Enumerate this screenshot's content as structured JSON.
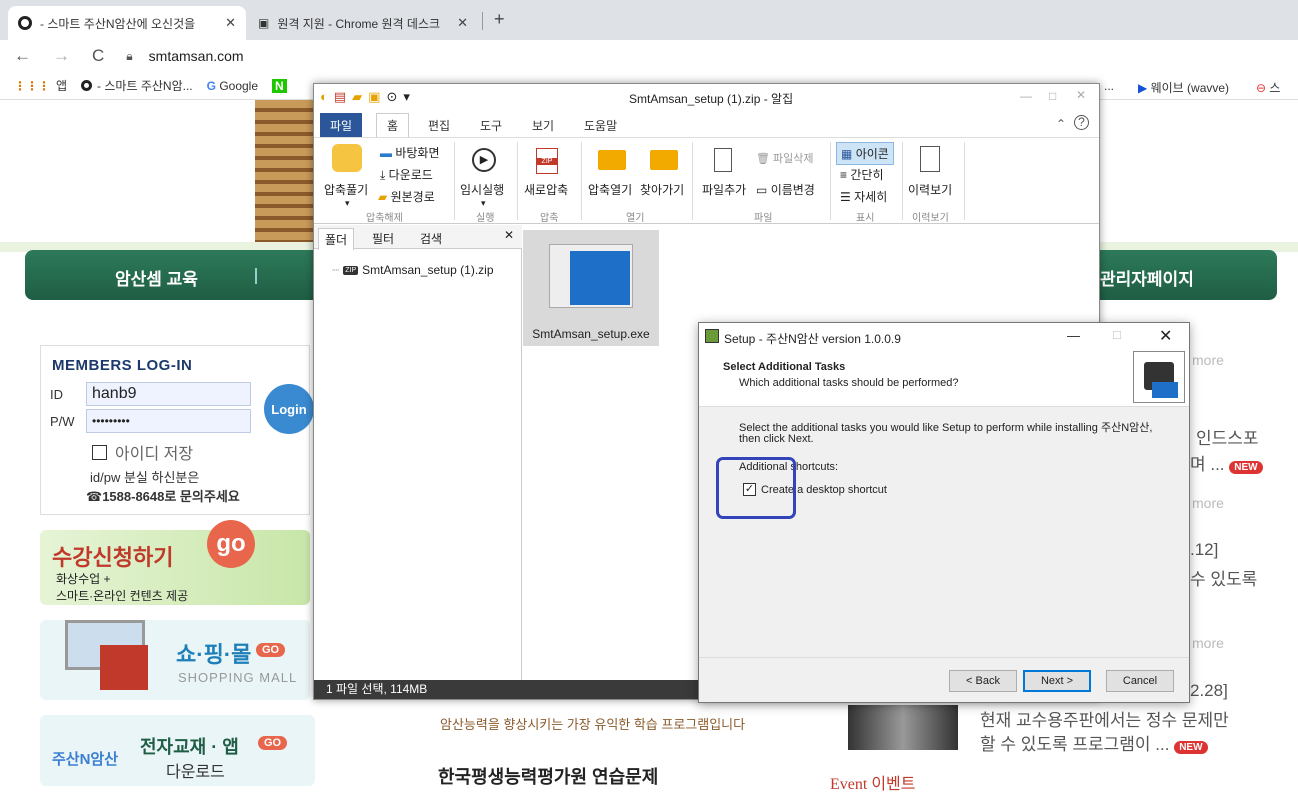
{
  "browser": {
    "tabs": [
      {
        "title": "- 스마트 주산N암산에 오신것을",
        "active": true
      },
      {
        "title": "원격 지원 - Chrome 원격 데스크",
        "active": false
      }
    ],
    "new_tab": "+",
    "url": "smtamsan.com",
    "bookmarks": [
      "앱",
      "- 스마트 주산N암...",
      "Google",
      "...",
      "웨이브 (wavve)",
      "스"
    ]
  },
  "site": {
    "nav_left": "암산셈 교육",
    "nav_right": "관리자페이지",
    "login_title": "MEMBERS  LOG-IN",
    "id_label": "ID",
    "pw_label": "P/W",
    "id_value": "hanb9",
    "pw_value": "•••••••••",
    "login_button": "Login",
    "save_id_label": "아이디 저장",
    "lost_text": "id/pw 분실 하신분은",
    "phone_text": "☎1588-8648로 문의주세요",
    "banner_register": "수강신청하기",
    "banner_register_sub1": "화상수업 +",
    "banner_register_sub2": "스마트·온라인 컨텐츠 제공",
    "banner_go": "go",
    "shop_title": "쇼·핑·몰",
    "shop_sub": "SHOPPING MALL",
    "ebook_brand": "주산N암산",
    "ebook_title": "전자교재 · 앱",
    "ebook_sub": "다운로드",
    "go_badge": "GO",
    "center_text1": "암산능력을 향상시키는 가장 유익한 학습 프로그램입니다",
    "center_text2": "한국평생능력평가원 연습문제",
    "right": {
      "more1": "more",
      "more2": "more",
      "more3": "more",
      "r1a": "인드스포",
      "r1b": "며 ...",
      "r2a": ".12]",
      "r2b": "수 있도록",
      "r3a": "2.28]",
      "r3b": "현재 교수용주판에서는 정수 문제만",
      "r3c": "할 수 있도록 프로그램이 ...",
      "new": "NEW",
      "event": "Event 이벤트"
    }
  },
  "bandizip": {
    "title": "SmtAmsan_setup (1).zip - 알집",
    "menus": [
      "파일",
      "홈",
      "편집",
      "도구",
      "보기",
      "도움말"
    ],
    "ribbon": {
      "extract": "압축풀기",
      "desktop": "바탕화면",
      "download": "다운로드",
      "original": "원본경로",
      "temp_run": "임시실행",
      "new_zip": "새로압축",
      "open_zip": "압축열기",
      "find": "찾아가기",
      "add_file": "파일추가",
      "delete_file": "파일삭제",
      "rename": "이름변경",
      "icon": "아이콘",
      "simple": "간단히",
      "detail": "자세히",
      "history": "이력보기",
      "group_extract": "압축해제",
      "group_run": "실행",
      "group_zip": "압축",
      "group_open": "열기",
      "group_file": "파일",
      "group_view": "표시",
      "group_history": "이력보기"
    },
    "panel_tabs": [
      "폴더",
      "필터",
      "검색"
    ],
    "tree_item": "SmtAmsan_setup (1).zip",
    "file_name": "SmtAmsan_setup.exe",
    "status": "1 파일 선택, 114MB"
  },
  "setup": {
    "title": "Setup - 주산N암산 version 1.0.0.9",
    "header_title": "Select Additional Tasks",
    "header_sub": "Which additional tasks should be performed?",
    "body_line1": "Select the additional tasks you would like Setup to perform while installing 주산N암산,",
    "body_line2": "then click Next.",
    "shortcuts_label": "Additional shortcuts:",
    "checkbox_label": "Create a desktop shortcut",
    "checkbox_checked": true,
    "back": "< Back",
    "next": "Next >",
    "cancel": "Cancel"
  },
  "colors": {
    "nav_green": "#2d7a5a",
    "office_blue": "#2b579a",
    "highlight": "#3344bb"
  }
}
